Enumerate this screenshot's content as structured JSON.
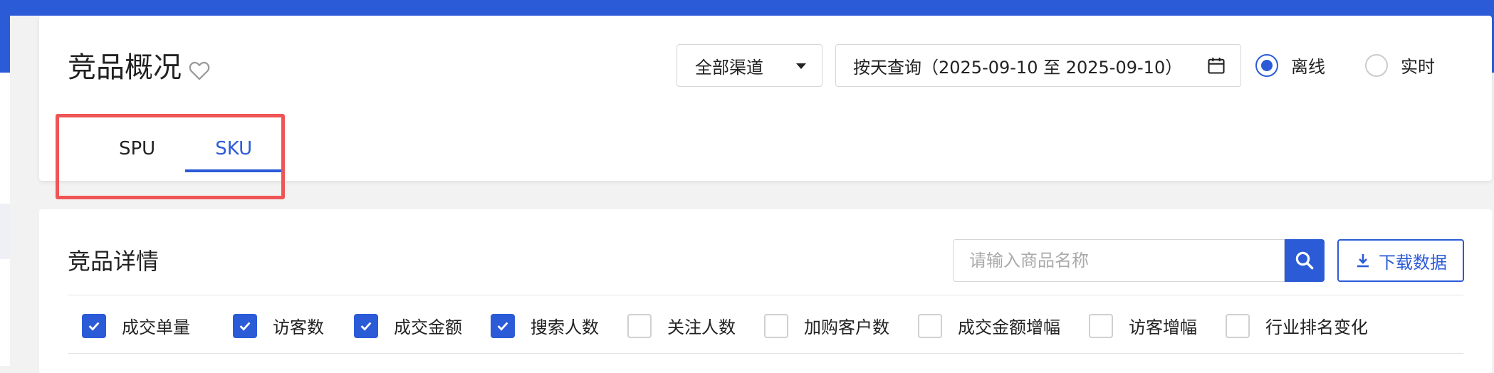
{
  "header": {
    "title": "竞品概况",
    "channel_select": "全部渠道",
    "date_range": "按天查询（2025-09-10 至 2025-09-10）",
    "radio_offline": "离线",
    "radio_realtime": "实时",
    "selected_mode": "离线"
  },
  "tabs": [
    {
      "label": "SPU",
      "active": false
    },
    {
      "label": "SKU",
      "active": true
    }
  ],
  "details": {
    "title": "竞品详情",
    "search_placeholder": "请输入商品名称",
    "download_label": "下载数据"
  },
  "metrics": [
    {
      "label": "成交单量",
      "checked": true
    },
    {
      "label": "访客数",
      "checked": true
    },
    {
      "label": "成交金额",
      "checked": true
    },
    {
      "label": "搜索人数",
      "checked": true
    },
    {
      "label": "关注人数",
      "checked": false
    },
    {
      "label": "加购客户数",
      "checked": false
    },
    {
      "label": "成交金额增幅",
      "checked": false
    },
    {
      "label": "访客增幅",
      "checked": false
    },
    {
      "label": "行业排名变化",
      "checked": false
    }
  ],
  "colors": {
    "accent": "#2b5bd7",
    "highlight": "#f05555"
  },
  "icons": {
    "favorite": "heart-outline-icon",
    "calendar": "calendar-icon",
    "search": "search-icon",
    "download": "download-icon",
    "dropdown": "caret-down-icon"
  }
}
